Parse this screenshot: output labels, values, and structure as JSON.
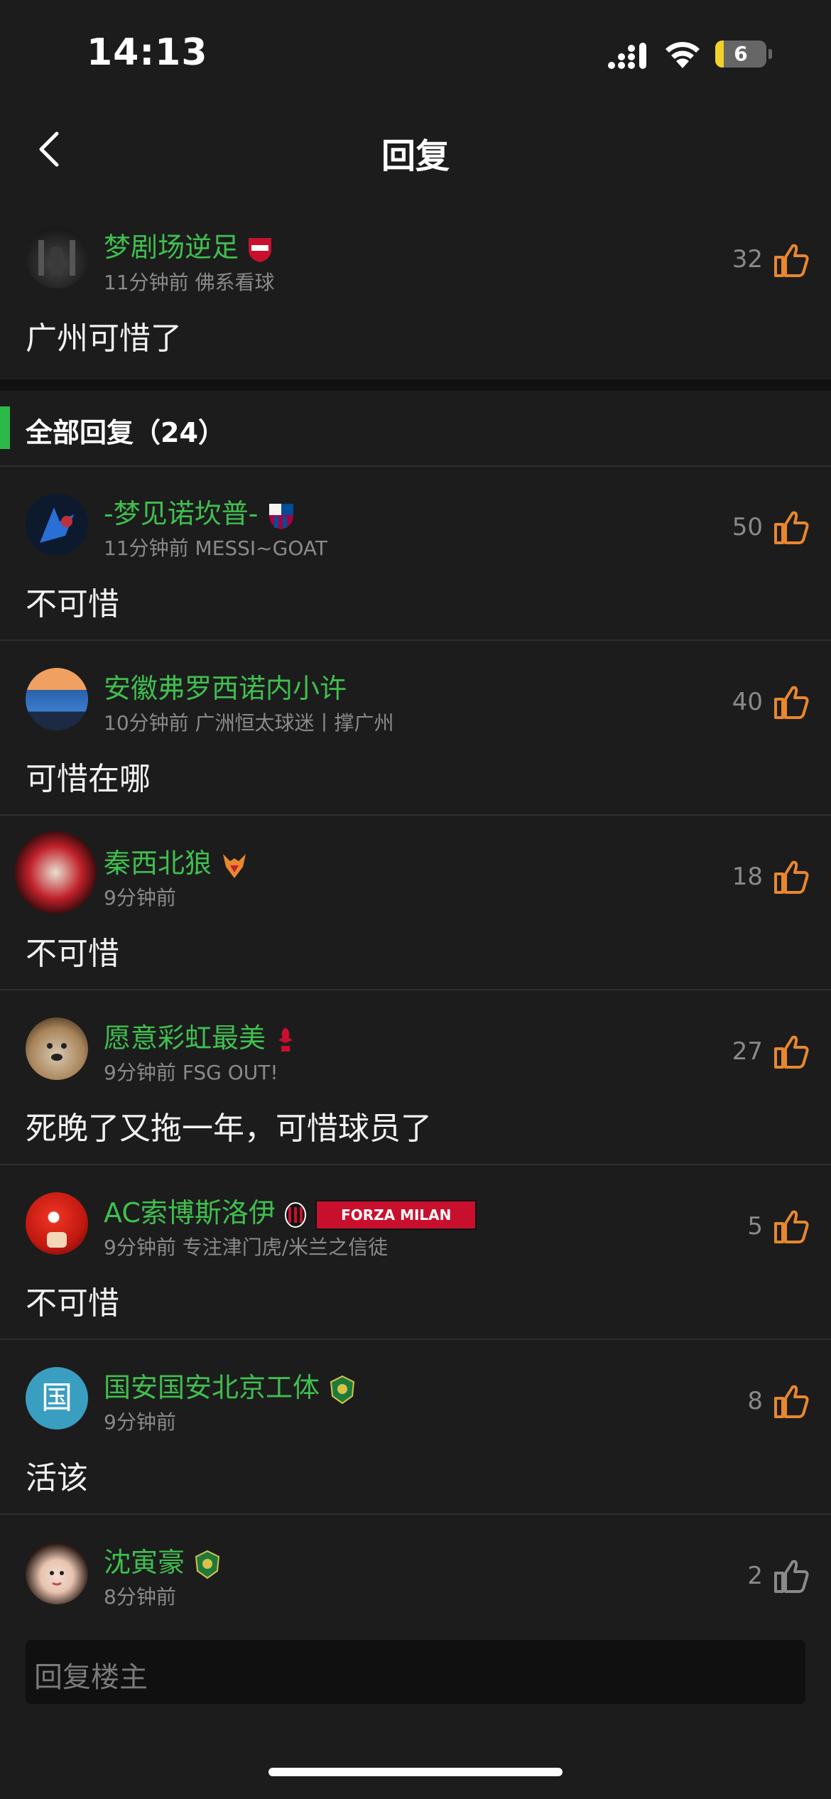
{
  "status": {
    "time": "14:13",
    "battery": "6"
  },
  "nav": {
    "title": "回复"
  },
  "main_comment": {
    "username": "梦剧场逆足",
    "meta": "11分钟前 佛系看球",
    "content": "广州可惜了",
    "likes": "32"
  },
  "section": {
    "title": "全部回复（24）"
  },
  "replies": [
    {
      "username": "-梦见诺坎普-",
      "meta": "11分钟前 MESSI~GOAT",
      "content": "不可惜",
      "likes": "50"
    },
    {
      "username": "安徽弗罗西诺内小许",
      "meta": "10分钟前 广洲恒太球迷丨撑广州",
      "content": "可惜在哪",
      "likes": "40"
    },
    {
      "username": "秦西北狼",
      "meta": "9分钟前",
      "content": "不可惜",
      "likes": "18"
    },
    {
      "username": "愿意彩虹最美",
      "meta": "9分钟前 FSG OUT!",
      "content": "死晚了又拖一年，可惜球员了",
      "likes": "27"
    },
    {
      "username": "AC索博斯洛伊",
      "meta": "9分钟前 专注津门虎/米兰之信徒",
      "content": "不可惜",
      "likes": "5",
      "banner": "FORZA MILAN"
    },
    {
      "username": "国安国安北京工体",
      "meta": "9分钟前",
      "content": "活该",
      "likes": "8",
      "avatar_char": "国"
    },
    {
      "username": "沈寅豪",
      "meta": "8分钟前",
      "content": "",
      "likes": "2"
    }
  ],
  "reply_input": {
    "placeholder": "回复楼主"
  },
  "colors": {
    "username": "#3fbf4f",
    "accent": "#2db84a",
    "like": "#e8872e",
    "background": "#1c1c1c"
  }
}
